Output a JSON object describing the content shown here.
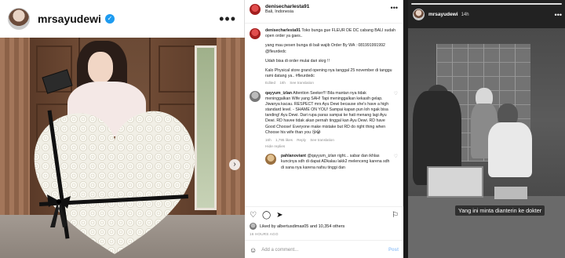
{
  "post": {
    "username": "mrsayudewi",
    "verified_icon": "✓"
  },
  "comments_panel": {
    "author": "denisecharlesta91",
    "location": "Bali, Indonesia",
    "caption": {
      "user": "denisecharlesta91",
      "text": "Toko bunga gue FLEUR DE DC cabang BALI sudah open order ya gaes..",
      "line2": "yang mau pesen bunga di bali wajib Order By WA : 081991991992 @fleurdedc",
      "line3": "Udah bisa di order mulai dari skrg !!",
      "line4": "Kalo Physical store grand opening nya tanggal 25 november di tanggu rami datang ya.. #fleurdedc",
      "meta_edited": "Edited",
      "meta_time": "16h",
      "meta_translation": "See translation"
    },
    "comment1": {
      "user": "qayyum_izlan",
      "text": "Attention Seeker!!! Bila mantan nya tidak meninggalkan Wife yang SAH! Tapi meninggalkan kekasih gelap. Jiwanya kacau. RESPECT mrs Ayu Dewi because she's have a high standard level. - SHAME ON YOU! Sampai kapan pun loh ngak bisa tanding! Ayu Dewi. Dari rupa paras sampai ke hati menang lagi Ayu Dewi. RD havee tidak akan pernah tinggal kan Ayu Dewi. RD have Good Choose! Everyone make mistake but RD do right thing when Choose his wife than you 😘😭",
      "meta_time": "16h",
      "meta_likes": "1,795 likes",
      "meta_reply": "Reply",
      "meta_translation": "See translation",
      "hide_replies": "Hide replies"
    },
    "reply1": {
      "user": "pahlanoviant",
      "text": "@qayyum_izlan right... sabar dan ikhlas kuncinya sdh di dapat ADkalau lakk2 melenceng karena sdh di sana nya karena nafsu tinggi dan"
    },
    "likes_text": "Liked by albertusdimas05 and 10,354 others",
    "time_ago": "16 HOURS AGO",
    "add_comment_placeholder": "Add a comment...",
    "post_label": "Post"
  },
  "story": {
    "username": "mrsayudewi",
    "time": "14h",
    "caption": "Yang ini minta dianterin ke dokter"
  }
}
